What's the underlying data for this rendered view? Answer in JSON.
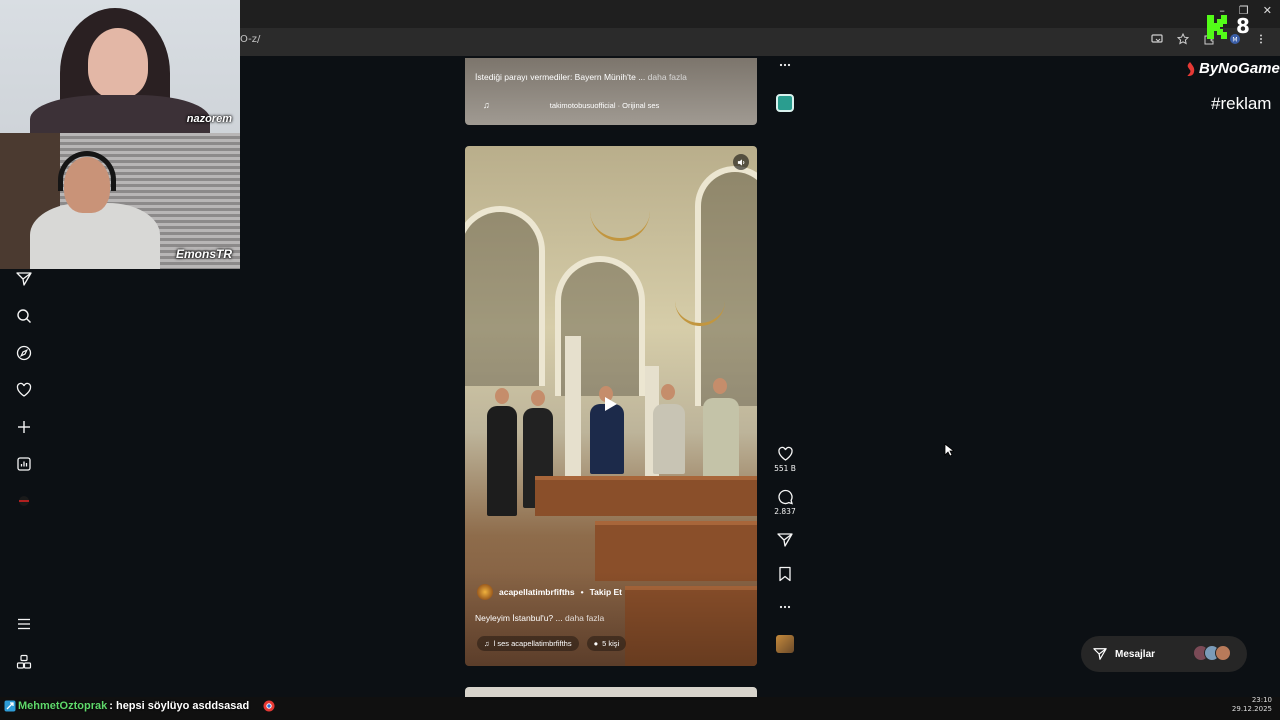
{
  "browser": {
    "url_fragment": "O-z/",
    "window_buttons": [
      "–",
      "❐",
      "✕"
    ]
  },
  "webcams": [
    {
      "label": "nazorem"
    },
    {
      "label": "EmonsTR"
    }
  ],
  "feed": {
    "previous_reel": {
      "caption": "İstediği parayı vermediler: Bayern Münih'te ...",
      "more_label": "daha fazla",
      "audio": "takimotobusuofficial · Orijinal ses"
    },
    "reel": {
      "username": "acapellatimbrfifths",
      "separator": "•",
      "follow_label": "Takip Et",
      "caption": "Neyleyim İstanbul'u? ...",
      "more_label": "daha fazla",
      "audio": "l ses  acapellatimbrfifths",
      "people": "5 kişi"
    },
    "actions": {
      "likes": "551 B",
      "comments": "2.837"
    }
  },
  "overlays": {
    "k_number": "8",
    "sponsor": "ByNoGame",
    "hashtag": "#reklam"
  },
  "messages_button": {
    "label": "Mesajlar"
  },
  "chat": {
    "username": "MehmetOztoprak",
    "message": ": hepsi söylüyo asddsasad"
  },
  "clock": {
    "time": "23:10",
    "date": "29.12.2025"
  },
  "colors": {
    "background": "#0c1014",
    "chat_username": "#5fd86b",
    "k_logo": "#53fc18",
    "sponsor_mark": "#e53935"
  }
}
